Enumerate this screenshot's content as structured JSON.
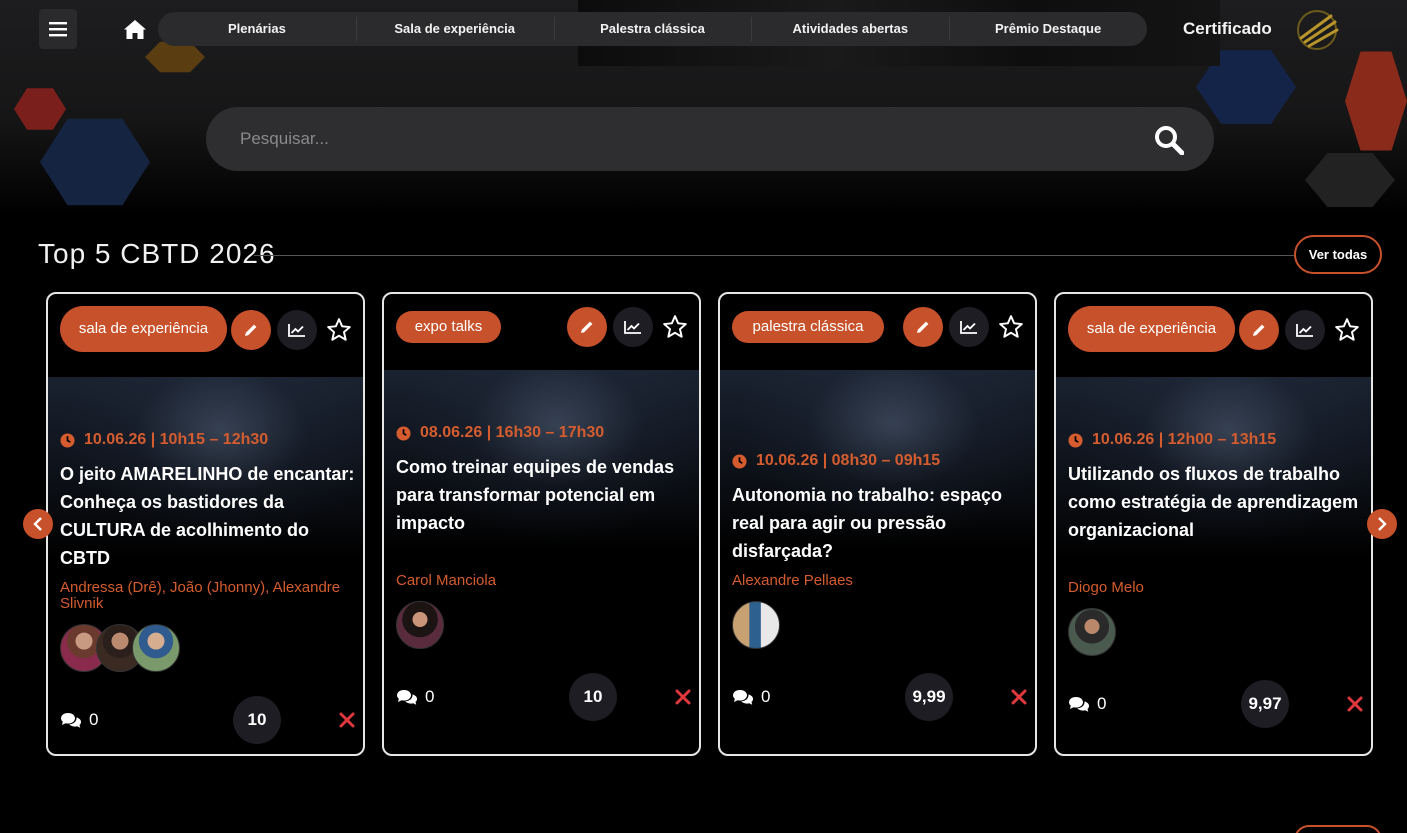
{
  "nav": {
    "items": [
      "Plenárias",
      "Sala de experiência",
      "Palestra clássica",
      "Atividades abertas",
      "Prêmio Destaque"
    ],
    "certificate_label": "Certificado"
  },
  "search": {
    "placeholder": "Pesquisar..."
  },
  "section": {
    "title": "Top 5 CBTD 2026",
    "see_all_label": "Ver todas"
  },
  "colors": {
    "accent": "#c7512a",
    "date": "#d45c2e",
    "background": "#000000",
    "score_bg": "#1e1d24",
    "close": "#e0383d"
  },
  "icons": [
    "menu-icon",
    "home-icon",
    "search-icon",
    "pencil-icon",
    "trend-icon",
    "star-icon",
    "clock-icon",
    "comments-icon",
    "close-icon",
    "chevron-left-icon",
    "chevron-right-icon"
  ],
  "cards": [
    {
      "tag": "sala de experiência",
      "date": "10.06.26 | 10h15 – 12h30",
      "title": "O jeito AMARELINHO de encantar: Conheça os bastidores da CULTURA de acolhimento do CBTD",
      "speakers": "Andressa (Drê), João (Jhonny), Alexandre Slivnik",
      "comments": "0",
      "score": "10"
    },
    {
      "tag": "expo talks",
      "date": "08.06.26 | 16h30 – 17h30",
      "title": "Como treinar equipes de vendas para transformar potencial em impacto",
      "speakers": "Carol Manciola",
      "comments": "0",
      "score": "10"
    },
    {
      "tag": "palestra clássica",
      "date": "10.06.26 | 08h30 – 09h15",
      "title": "Autonomia no trabalho: espaço real para agir ou pressão disfarçada?",
      "speakers": "Alexandre Pellaes",
      "comments": "0",
      "score": "9,99"
    },
    {
      "tag": "sala de experiência",
      "date": "10.06.26 | 12h00 – 13h15",
      "title": "Utilizando os fluxos de trabalho como estratégia de aprendizagem organizacional",
      "speakers": "Diogo Melo",
      "comments": "0",
      "score": "9,97"
    }
  ]
}
